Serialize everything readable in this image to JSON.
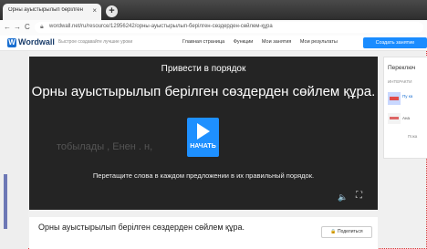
{
  "browser": {
    "tab_title": "Орны ауыстырылып берілген",
    "tab_close": "×",
    "new_tab": "+",
    "back": "←",
    "forward": "→",
    "reload": "C",
    "url": "wordwall.net/ru/resource/12956242/орны-ауыстырылып-берілген-сөздерден-сөйлем-құра"
  },
  "header": {
    "logo": "Wordwall",
    "logo_mark": "W",
    "tagline": "Быстрое создавайте лучшие уроки",
    "nav": [
      "Главная страница",
      "Функции",
      "Мои занятия",
      "Мои результаты"
    ],
    "create_button": "Создать занятие"
  },
  "game": {
    "subtitle": "Привести в порядок",
    "title": "Орны ауыстырылып берілген сөздерден сөйлем құра.",
    "words_preview": "тобылады , Енен . н,",
    "play_label": "НАЧАТЬ",
    "instructions": "Перетащите слова в каждом предложении в их правильный порядок.",
    "sound_icon": "🔈",
    "fullscreen_icon": "⛶"
  },
  "info": {
    "title": "Орны ауыстырылып берілген сөздерден сөйлем құра.",
    "share_button": "Поделиться",
    "share_icon": "🔒"
  },
  "right_panel": {
    "title": "Переключ",
    "subtitle": "ИНТЕРАКТИ",
    "item1": "Пу\nка",
    "item2": "Ана",
    "show_more": "Пока"
  },
  "colors": {
    "accent": "#1a8cff",
    "game_bg": "#242424"
  }
}
